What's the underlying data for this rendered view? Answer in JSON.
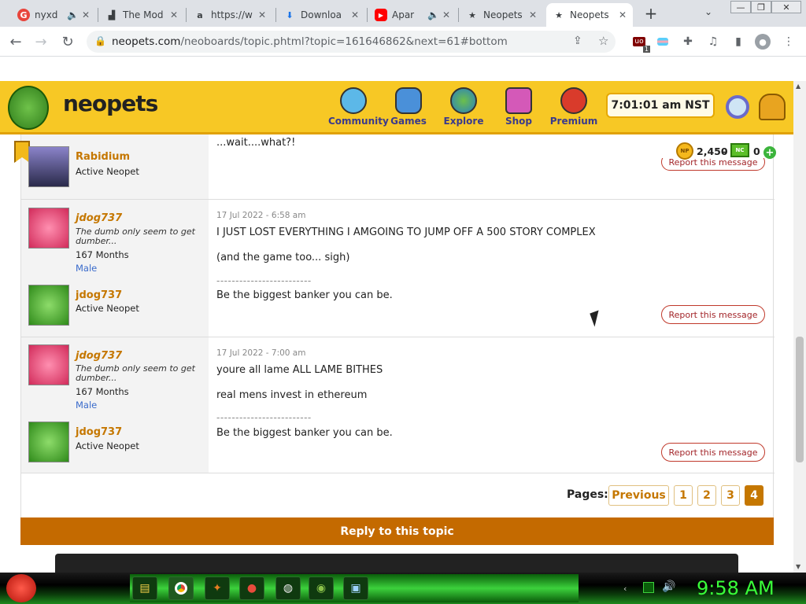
{
  "browser": {
    "tabs": [
      {
        "title": "nyxd",
        "icon": "g-icon",
        "has_audio": true
      },
      {
        "title": "The Mod",
        "icon": "chart-icon"
      },
      {
        "title": "https://w",
        "icon": "amazon-icon"
      },
      {
        "title": "Downloa",
        "icon": "download-icon"
      },
      {
        "title": "Apar",
        "icon": "youtube-icon",
        "has_audio": true
      },
      {
        "title": "Neopets",
        "icon": "star-icon"
      },
      {
        "title": "Neopets",
        "icon": "star-icon",
        "active": true
      }
    ],
    "url_host": "neopets.com",
    "url_path": "/neoboards/topic.phtml?topic=161646862&next=61#bottom",
    "extension_badge": "1"
  },
  "header": {
    "logo": "neopets",
    "nav": [
      "Community",
      "Games",
      "Explore",
      "Shop",
      "Premium"
    ],
    "nst_time": "7:01:01 am NST",
    "neopoints": "2,450",
    "separator": "-",
    "neocash": "0"
  },
  "posts": [
    {
      "message": "...wait....what?!",
      "users": [
        {
          "name": "Rabidium",
          "status": "Active Neopet"
        }
      ],
      "report_label": "Report this message"
    },
    {
      "date": "17 Jul 2022 - 6:58 am",
      "lines": [
        "I JUST LOST EVERYTHING I AMGOING TO JUMP OFF A 500 STORY COMPLEX",
        "(and the game too... sigh)"
      ],
      "signature_divider": "-------------------------",
      "signature": "Be the biggest banker you can be.",
      "author": {
        "name": "jdog737",
        "title": "The dumb only seem to get dumber...",
        "months": "167 Months",
        "gender": "Male"
      },
      "pet": {
        "name": "jdog737",
        "status": "Active Neopet"
      },
      "report_label": "Report this message"
    },
    {
      "date": "17 Jul 2022 - 7:00 am",
      "lines": [
        "youre all lame ALL LAME BITHES",
        "real mens invest in ethereum"
      ],
      "signature_divider": "-------------------------",
      "signature": "Be the biggest banker you can be.",
      "author": {
        "name": "jdog737",
        "title": "The dumb only seem to get dumber...",
        "months": "167 Months",
        "gender": "Male"
      },
      "pet": {
        "name": "jdog737",
        "status": "Active Neopet"
      },
      "report_label": "Report this message"
    }
  ],
  "pagination": {
    "label": "Pages:",
    "previous": "Previous",
    "pages": [
      "1",
      "2",
      "3",
      "4"
    ],
    "current": "4"
  },
  "reply_label": "Reply to this topic",
  "taskbar": {
    "clock": "9:58 AM"
  },
  "colors": {
    "header_yellow": "#f7c825",
    "accent_orange": "#c57700",
    "reply_bar": "#c46a00",
    "report_red": "#a3262a"
  }
}
